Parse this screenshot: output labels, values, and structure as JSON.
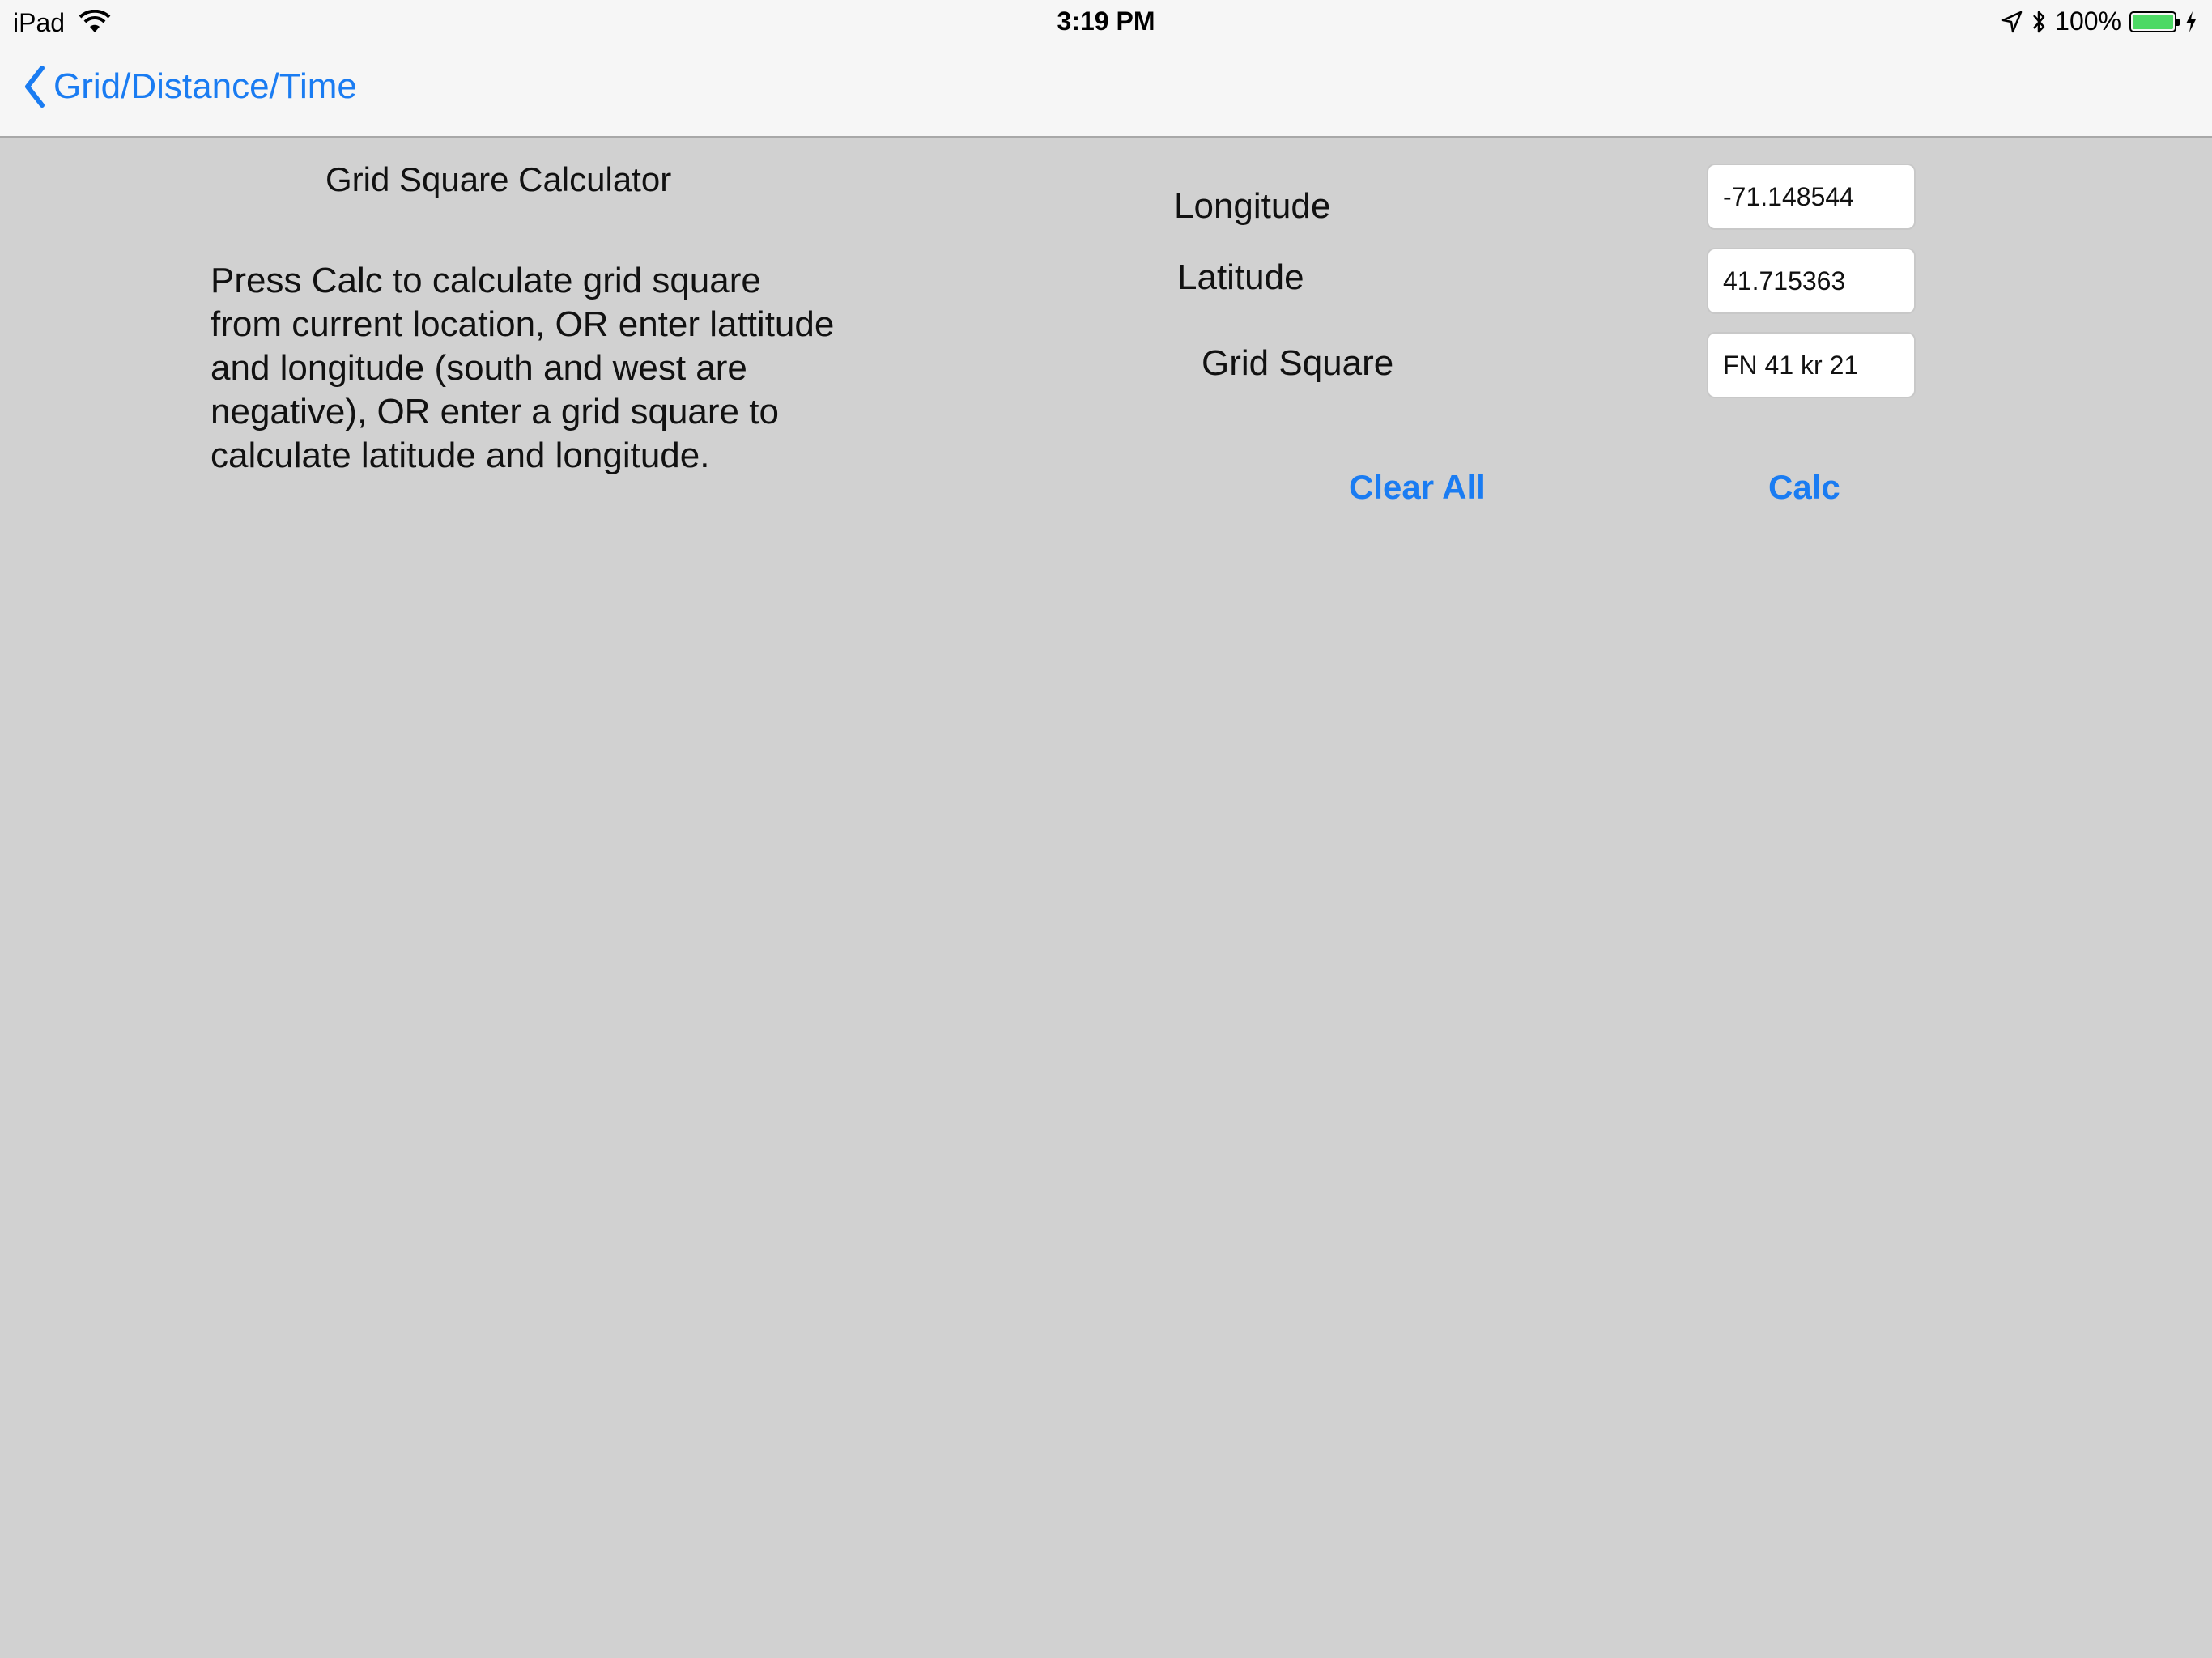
{
  "status_bar": {
    "device": "iPad",
    "time": "3:19 PM",
    "battery_text": "100%",
    "battery_level": 1.0,
    "battery_color": "#4cd964",
    "icons": [
      "wifi-icon",
      "location-arrow-icon",
      "bluetooth-icon",
      "battery-icon",
      "charging-bolt-icon"
    ]
  },
  "nav": {
    "back_label": "Grid/Distance/Time",
    "accent_color": "#1a7cf2"
  },
  "main": {
    "title": "Grid Square Calculator",
    "description": "Press Calc to calculate grid square from current location, OR enter lattitude and longitude (south and west are negative), OR enter a grid square to calculate latitude and longitude.",
    "fields": {
      "longitude": {
        "label": "Longitude",
        "value": "-71.148544"
      },
      "latitude": {
        "label": "Latitude",
        "value": "41.715363"
      },
      "grid_square": {
        "label": "Grid Square",
        "value": "FN 41 kr 21"
      }
    },
    "buttons": {
      "clear_all": "Clear All",
      "calc": "Calc"
    }
  }
}
